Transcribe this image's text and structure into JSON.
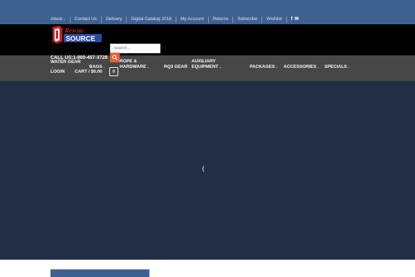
{
  "top_nav": {
    "items": [
      {
        "label": "About",
        "has_caret": true
      },
      {
        "label": "Contact Us"
      },
      {
        "label": "Delivery"
      },
      {
        "label": "Digital Catalog 2018"
      },
      {
        "label": "My Account"
      },
      {
        "label": "Returns"
      },
      {
        "label": "Subscribe"
      },
      {
        "label": "Wishlist"
      }
    ],
    "caret": "⌄",
    "social": {
      "facebook": "f",
      "email": "✉"
    }
  },
  "header": {
    "logo_text_line1": "Rescue",
    "logo_text_line2": "SOURCE",
    "search_placeholder": "Search...",
    "call_us": "CALL US:1-800-457-3728"
  },
  "main_nav": {
    "water_gear_line1": "WATER GEAR",
    "bags": "BAGS",
    "rope_line1": "ROPE &",
    "rope_line2": "HARDWARE",
    "rq3": "RQ3 GEAR",
    "aux_line1": "AUXILIARY",
    "aux_line2": "EQUIPMENT",
    "packages": "PACKAGES",
    "accessories": "ACCESSORIES",
    "specials": "SPECIALS",
    "login": "LOGIN",
    "cart": "CART / $0.00",
    "cart_count": "0",
    "caret": "⌄"
  },
  "hero": {
    "loader": "("
  },
  "colors": {
    "topbar": "#3f6191",
    "header": "#000000",
    "navbar": "#474747",
    "hero": "#212e46",
    "accent": "#e0643a"
  }
}
